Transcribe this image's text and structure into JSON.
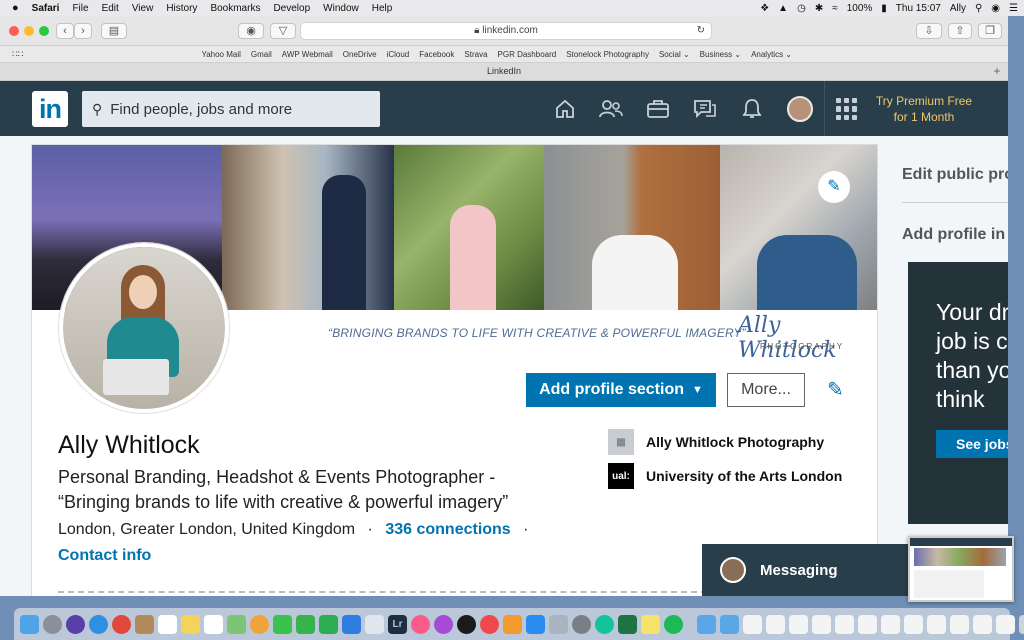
{
  "menubar": {
    "apple": "",
    "app": "Safari",
    "items": [
      "File",
      "Edit",
      "View",
      "History",
      "Bookmarks",
      "Develop",
      "Window",
      "Help"
    ],
    "battery": "100%",
    "clock": "Thu 15:07",
    "user": "Ally"
  },
  "browser": {
    "url": "linkedin.com",
    "tab_title": "LinkedIn",
    "favorites": [
      "Yahoo Mail",
      "Gmail",
      "AWP Webmail",
      "OneDrive",
      "iCloud",
      "Facebook",
      "Strava",
      "PGR Dashboard",
      "Stonelock Photography",
      "Social ⌄",
      "Business ⌄",
      "Analytics ⌄"
    ]
  },
  "header": {
    "logo": "in",
    "search_placeholder": "Find people, jobs and more",
    "premium_line1": "Try Premium Free",
    "premium_line2": "for 1 Month"
  },
  "profile": {
    "banner_tagline": "“BRINGING BRANDS TO LIFE WITH CREATIVE & POWERFUL IMAGERY”",
    "banner_logo": "Ally Whitlock",
    "banner_logo_sub": "PHOTOGRAPHY",
    "add_section_label": "Add profile section",
    "more_label": "More...",
    "name": "Ally Whitlock",
    "headline_line1": "Personal Branding, Headshot & Events Photographer -",
    "headline_line2": "“Bringing brands to life with creative & powerful imagery”",
    "location": "London, Greater London, United Kingdom",
    "separator": "·",
    "connections": "336 connections",
    "contact_info": "Contact info",
    "experience": [
      {
        "name": "Ally Whitlock Photography",
        "logo_text": ""
      },
      {
        "name": "University of the Arts London",
        "logo_text": "ual:"
      }
    ]
  },
  "sidebar": {
    "edit_public": "Edit public profile & URL",
    "add_language": "Add profile in another language",
    "ad_line1": "Your dream",
    "ad_line2": "job is closer",
    "ad_line3": "than you",
    "ad_line4": "think",
    "ad_button": "See jobs"
  },
  "messaging": {
    "label": "Messaging"
  },
  "colors": {
    "linkedin_blue": "#0073b1",
    "header_bg": "#283e4a",
    "premium_gold": "#f2c66a"
  }
}
